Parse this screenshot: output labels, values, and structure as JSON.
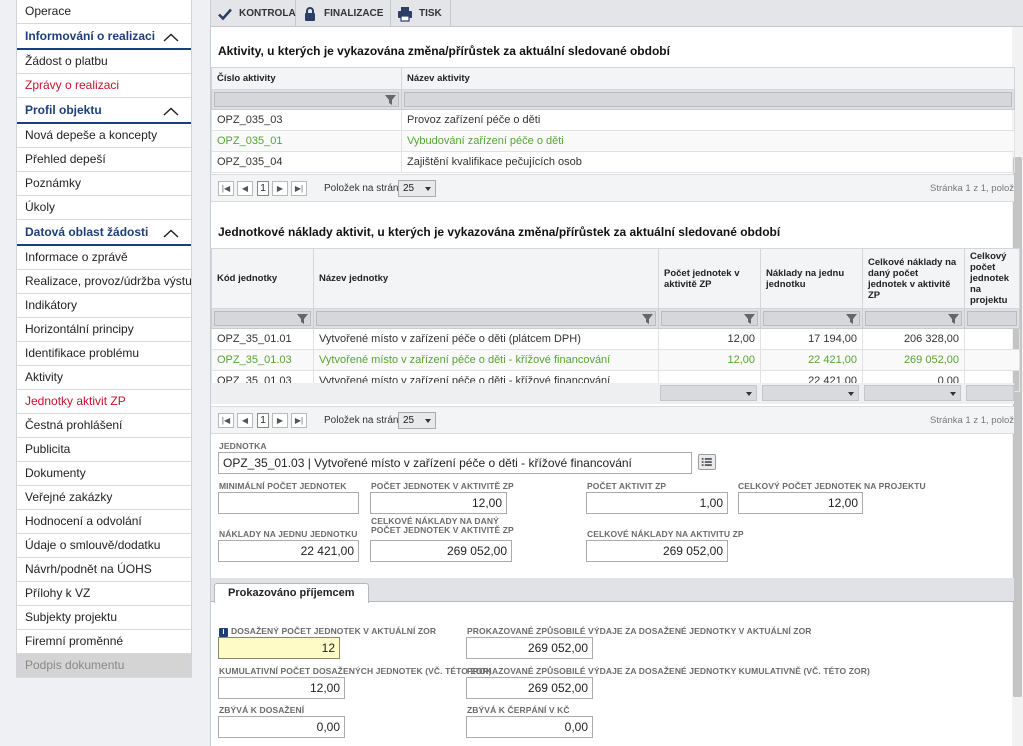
{
  "sidebar": {
    "items": [
      {
        "label": "Operace",
        "kind": "item"
      },
      {
        "label": "Informování o realizaci",
        "kind": "section"
      },
      {
        "label": "Žádost o platbu",
        "kind": "item"
      },
      {
        "label": "Zprávy o realizaci",
        "kind": "active"
      },
      {
        "label": "Profil objektu",
        "kind": "section"
      },
      {
        "label": "Nová depeše a koncepty",
        "kind": "item"
      },
      {
        "label": "Přehled depeší",
        "kind": "item"
      },
      {
        "label": "Poznámky",
        "kind": "item"
      },
      {
        "label": "Úkoly",
        "kind": "item"
      },
      {
        "label": "Datová oblast žádosti",
        "kind": "section"
      },
      {
        "label": "Informace o zprávě",
        "kind": "item"
      },
      {
        "label": "Realizace, provoz/údržba výstupu",
        "kind": "item"
      },
      {
        "label": "Indikátory",
        "kind": "item"
      },
      {
        "label": "Horizontální principy",
        "kind": "item"
      },
      {
        "label": "Identifikace problému",
        "kind": "item"
      },
      {
        "label": "Aktivity",
        "kind": "item"
      },
      {
        "label": "Jednotky aktivit ZP",
        "kind": "active"
      },
      {
        "label": "Čestná prohlášení",
        "kind": "item"
      },
      {
        "label": "Publicita",
        "kind": "item"
      },
      {
        "label": "Dokumenty",
        "kind": "item"
      },
      {
        "label": "Veřejné zakázky",
        "kind": "item"
      },
      {
        "label": "Hodnocení a odvolání",
        "kind": "item"
      },
      {
        "label": "Údaje o smlouvě/dodatku",
        "kind": "item"
      },
      {
        "label": "Návrh/podnět na ÚOHS",
        "kind": "item"
      },
      {
        "label": "Přílohy k VZ",
        "kind": "item"
      },
      {
        "label": "Subjekty projektu",
        "kind": "item"
      },
      {
        "label": "Firemní proměnné",
        "kind": "item"
      },
      {
        "label": "Podpis dokumentu",
        "kind": "disabled"
      }
    ]
  },
  "toolbar": {
    "kontrola": "KONTROLA",
    "finalizace": "FINALIZACE",
    "tisk": "TISK"
  },
  "activities": {
    "title": "Aktivity, u kterých je vykazována změna/přírůstek za aktuální sledované období",
    "col_code": "Číslo aktivity",
    "col_name": "Název aktivity",
    "rows": [
      {
        "code": "OPZ_035_03",
        "name": "Provoz zařízení péče o děti"
      },
      {
        "code": "OPZ_035_01",
        "name": "Vybudování zařízení péče o děti"
      },
      {
        "code": "OPZ_035_04",
        "name": "Zajištění kvalifikace pečujících osob"
      }
    ]
  },
  "pager": {
    "page": "1",
    "per_page_label": "Položek na stránku",
    "per_page": "25",
    "info1": "Stránka 1 z 1, polož",
    "info2": "Stránka 1 z 1, polož"
  },
  "units": {
    "title": "Jednotkové náklady aktivit, u kterých je vykazována změna/přírůstek za aktuální sledované období",
    "cols": {
      "code": "Kód jednotky",
      "name": "Název jednotky",
      "count": "Počet jednotek v aktivitě ZP",
      "cost": "Náklady na jednu jednotku",
      "total": "Celkové náklady na daný počet jednotek v aktivitě ZP",
      "proj": "Celkový počet jednotek na projektu"
    },
    "rows": [
      {
        "code": "OPZ_35_01.01",
        "name": "Vytvořené místo v zařízení péče o děti (plátcem DPH)",
        "count": "12,00",
        "cost": "17 194,00",
        "total": "206 328,00"
      },
      {
        "code": "OPZ_35_01.03",
        "name": "Vytvořené místo v zařízení péče o děti - křížové financování",
        "count": "12,00",
        "cost": "22 421,00",
        "total": "269 052,00"
      },
      {
        "code": "OPZ_35_01.03",
        "name": "Vytvořené místo v zařízení péče o děti - křížové financování",
        "count": "",
        "cost": "22 421,00",
        "total": "0,00"
      }
    ]
  },
  "detail": {
    "jednotka_label": "JEDNOTKA",
    "jednotka_value": "OPZ_35_01.03 | Vytvořené místo v zařízení péče o děti - křížové financování",
    "min_label": "MINIMÁLNÍ POČET JEDNOTEK",
    "min_value": "",
    "count_label": "POČET JEDNOTEK V AKTIVITĚ ZP",
    "count_value": "12,00",
    "act_label": "POČET AKTIVIT ZP",
    "act_value": "1,00",
    "proj_label": "CELKOVÝ POČET JEDNOTEK NA PROJEKTU",
    "proj_value": "12,00",
    "cost_label": "NÁKLADY NA JEDNU JEDNOTKU",
    "cost_value": "22 421,00",
    "total_label_1": "CELKOVÉ NÁKLADY NA DANÝ",
    "total_label_2": "POČET JEDNOTEK V AKTIVITĚ ZP",
    "total_value": "269 052,00",
    "act_total_label": "CELKOVÉ NÁKLADY NA AKTIVITU ZP",
    "act_total_value": "269 052,00"
  },
  "tab": {
    "label": "Prokazováno příjemcem"
  },
  "proof": {
    "achieved_label": "DOSAŽENÝ POČET JEDNOTEK V AKTUÁLNÍ ZOR",
    "achieved_value": "12",
    "exp_label": "PROKAZOVANÉ ZPŮSOBILÉ VÝDAJE ZA DOSAŽENÉ JEDNOTKY V AKTUÁLNÍ ZOR",
    "exp_value": "269 052,00",
    "cum_label": "KUMULATIVNÍ POČET DOSAŽENÝCH JEDNOTEK (VČ. TÉTO ZOR)",
    "cum_value": "12,00",
    "cum_exp_label": "PROKAZOVANÉ ZPŮSOBILÉ VÝDAJE ZA DOSAŽENÉ JEDNOTKY KUMULATIVNĚ (VČ. TÉTO ZOR)",
    "cum_exp_value": "269 052,00",
    "remain_label": "ZBÝVÁ K DOSAŽENÍ",
    "remain_value": "0,00",
    "remain_kc_label": "ZBÝVÁ K ČERPÁNÍ V KČ",
    "remain_kc_value": "0,00"
  },
  "colors": {
    "accent": "#1c3f7c",
    "active_item": "#c8102e",
    "selected_row": "#55a630",
    "highlight_field": "#fffbc6"
  },
  "icons": [
    "checkmark-icon",
    "lock-icon",
    "printer-icon",
    "chevron-up-icon",
    "funnel-icon",
    "list-icon",
    "info-icon"
  ]
}
